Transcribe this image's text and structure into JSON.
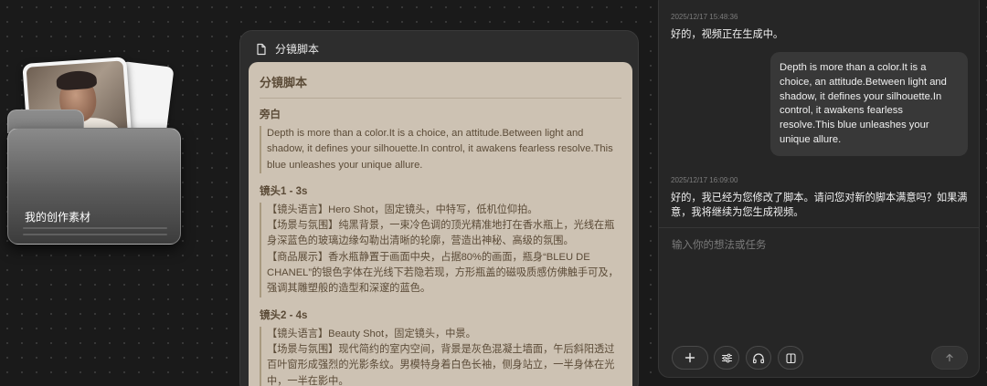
{
  "folder": {
    "label": "我的创作素材"
  },
  "script_panel": {
    "header_title": "分镜脚本",
    "doc_title": "分镜脚本",
    "sections": [
      {
        "title": "旁白",
        "lines": [
          "Depth is more than a color.It is a choice, an attitude.Between light and shadow, it defines your silhouette.In control, it awakens fearless resolve.This blue unleashes your unique allure."
        ]
      },
      {
        "title": "镜头1 - 3s",
        "lines": [
          "【镜头语言】Hero Shot，固定镜头，中特写，低机位仰拍。",
          "【场景与氛围】纯黑背景，一束冷色调的顶光精准地打在香水瓶上，光线在瓶身深蓝色的玻璃边缘勾勒出清晰的轮廓，营造出神秘、高级的氛围。",
          "【商品展示】香水瓶静置于画面中央，占据80%的画面，瓶身“BLEU DE CHANEL”的银色字体在光线下若隐若现，方形瓶盖的磁吸质感仿佛触手可及，强调其雕塑般的造型和深邃的蓝色。"
        ]
      },
      {
        "title": "镜头2 - 4s",
        "lines": [
          "【镜头语言】Beauty Shot，固定镜头，中景。",
          "【场景与氛围】现代简约的室内空间，背景是灰色混凝土墙面，午后斜阳透过百叶窗形成强烈的光影条纹。男模特身着白色长袖，侧身站立，一半身体在光中，一半在影中。"
        ]
      }
    ]
  },
  "chat": {
    "messages": [
      {
        "timestamp": "2025/12/17 15:48:36",
        "ai_text": "好的，视频正在生成中。"
      },
      {
        "user_text": "Depth is more than a color.It is a choice, an attitude.Between light and shadow, it defines your silhouette.In control, it awakens fearless resolve.This blue unleashes your unique allure."
      },
      {
        "timestamp": "2025/12/17 16:09:00",
        "ai_text": "好的，我已经为您修改了脚本。请问您对新的脚本满意吗？如果满意，我将继续为您生成视频。"
      }
    ],
    "input_placeholder": "输入你的想法或任务",
    "tool_icons": [
      "plus-icon",
      "sliders-icon",
      "headphones-icon",
      "book-icon"
    ],
    "send_icon": "arrow-up-icon"
  }
}
